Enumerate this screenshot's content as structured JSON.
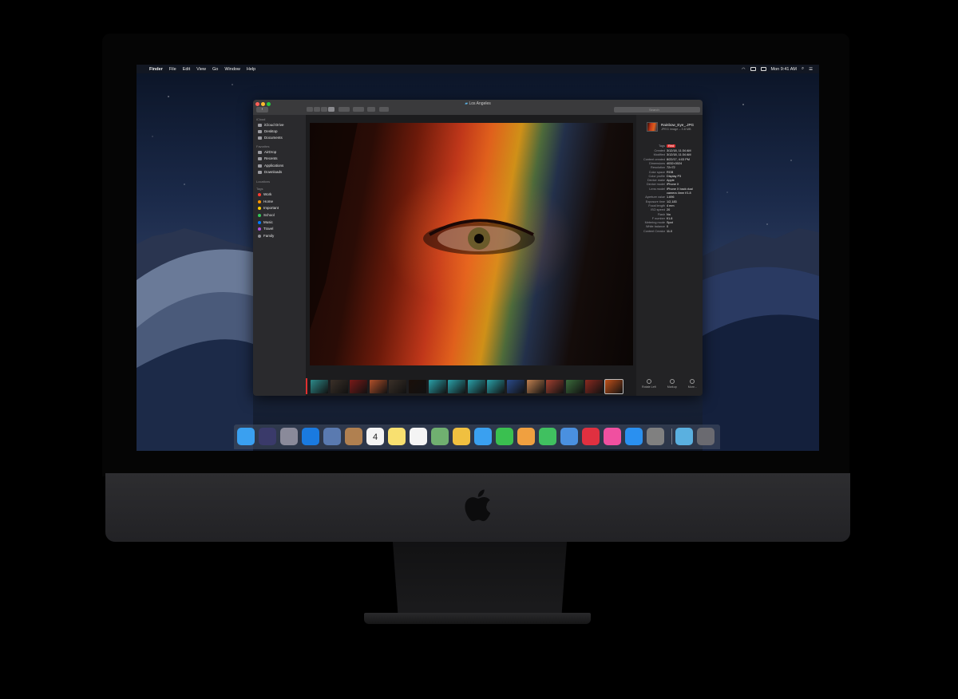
{
  "menubar": {
    "apple": "",
    "items": [
      "Finder",
      "File",
      "Edit",
      "View",
      "Go",
      "Window",
      "Help"
    ],
    "clock": "Mon 9:41 AM"
  },
  "window": {
    "title": "Los Angeles",
    "search_placeholder": "Search",
    "back": "‹"
  },
  "sidebar": {
    "icloud_header": "iCloud",
    "icloud": [
      "iCloud Drive",
      "Desktop",
      "Documents"
    ],
    "favorites_header": "Favorites",
    "favorites": [
      "AirDrop",
      "Recents",
      "Applications",
      "Downloads"
    ],
    "locations_header": "Locations",
    "tags_header": "Tags",
    "tags": [
      {
        "label": "Work",
        "color": "#ff3b30"
      },
      {
        "label": "Home",
        "color": "#ff9500"
      },
      {
        "label": "Important",
        "color": "#ffcc00"
      },
      {
        "label": "School",
        "color": "#34c759"
      },
      {
        "label": "Music",
        "color": "#007aff"
      },
      {
        "label": "Travel",
        "color": "#af52de"
      },
      {
        "label": "Family",
        "color": "#8e8e93"
      }
    ]
  },
  "info": {
    "filename": "Rainbow_Eye_.JPG",
    "subtitle": "JPEG image – 3.8 MB",
    "tags_label": "Tags",
    "tag": "Red",
    "rows": [
      {
        "k": "Created",
        "v": "3/12/18, 11:34 AM"
      },
      {
        "k": "Modified",
        "v": "3/12/18, 11:34 AM"
      },
      {
        "k": "Content created",
        "v": "8/22/17, 4:03 PM"
      },
      {
        "k": "Dimensions",
        "v": "4032×3024"
      },
      {
        "k": "Resolution",
        "v": "72×72"
      },
      {
        "k": "Color space",
        "v": "RGB"
      },
      {
        "k": "Color profile",
        "v": "Display P3"
      },
      {
        "k": "Device make",
        "v": "Apple"
      },
      {
        "k": "Device model",
        "v": "iPhone X"
      },
      {
        "k": "Lens model",
        "v": "iPhone X back dual"
      },
      {
        "k": "",
        "v": "camera 4mm f/1.8"
      },
      {
        "k": "Aperture value",
        "v": "1.696"
      },
      {
        "k": "Exposure time",
        "v": "1/2,183"
      },
      {
        "k": "Focal length",
        "v": "4 mm"
      },
      {
        "k": "ISO speed",
        "v": "20"
      },
      {
        "k": "Flash",
        "v": "No"
      },
      {
        "k": "F number",
        "v": "f/1.8"
      },
      {
        "k": "Metering mode",
        "v": "Spot"
      },
      {
        "k": "White balance",
        "v": "0"
      },
      {
        "k": "Content Creator",
        "v": "11.0"
      }
    ],
    "actions": [
      "Rotate Left",
      "Markup",
      "More..."
    ]
  },
  "filmstrip": {
    "thumb_colors": [
      "#2d8a8a",
      "#3a3028",
      "#7a1a18",
      "#b0502a",
      "#3a3028",
      "#1a0f0a",
      "#2aa0a8",
      "#2aa0a8",
      "#2aa0a8",
      "#2aa0a8",
      "#2a4a8a",
      "#c08050",
      "#a04030",
      "#3a6a3a",
      "#8a2a20",
      "#c0501a"
    ]
  },
  "dock": {
    "apps": [
      {
        "name": "finder-icon",
        "color": "#3aa0f0"
      },
      {
        "name": "siri-icon",
        "color": "#3a3a6a"
      },
      {
        "name": "launchpad-icon",
        "color": "#8a8a9a"
      },
      {
        "name": "safari-icon",
        "color": "#1a7ae0"
      },
      {
        "name": "preview-icon",
        "color": "#5a7ab0"
      },
      {
        "name": "contacts-icon",
        "color": "#b08050"
      },
      {
        "name": "calendar-icon",
        "color": "#f4f4f4"
      },
      {
        "name": "notes-icon",
        "color": "#f8e070"
      },
      {
        "name": "reminders-icon",
        "color": "#f4f4f4"
      },
      {
        "name": "maps-icon",
        "color": "#70b070"
      },
      {
        "name": "photos-icon",
        "color": "#f0c040"
      },
      {
        "name": "messages-icon",
        "color": "#3aa0f0"
      },
      {
        "name": "facetime-icon",
        "color": "#3ac050"
      },
      {
        "name": "pages-icon",
        "color": "#f0a040"
      },
      {
        "name": "numbers-icon",
        "color": "#40c060"
      },
      {
        "name": "keynote-icon",
        "color": "#4a90e0"
      },
      {
        "name": "news-icon",
        "color": "#e03040"
      },
      {
        "name": "itunes-icon",
        "color": "#f050a0"
      },
      {
        "name": "app-store-icon",
        "color": "#2a90f0"
      },
      {
        "name": "system-preferences-icon",
        "color": "#808080"
      },
      {
        "name": "downloads-folder-icon",
        "color": "#5ab0e0"
      },
      {
        "name": "trash-icon",
        "color": "#6a6a70"
      }
    ],
    "calendar_day": "4"
  }
}
